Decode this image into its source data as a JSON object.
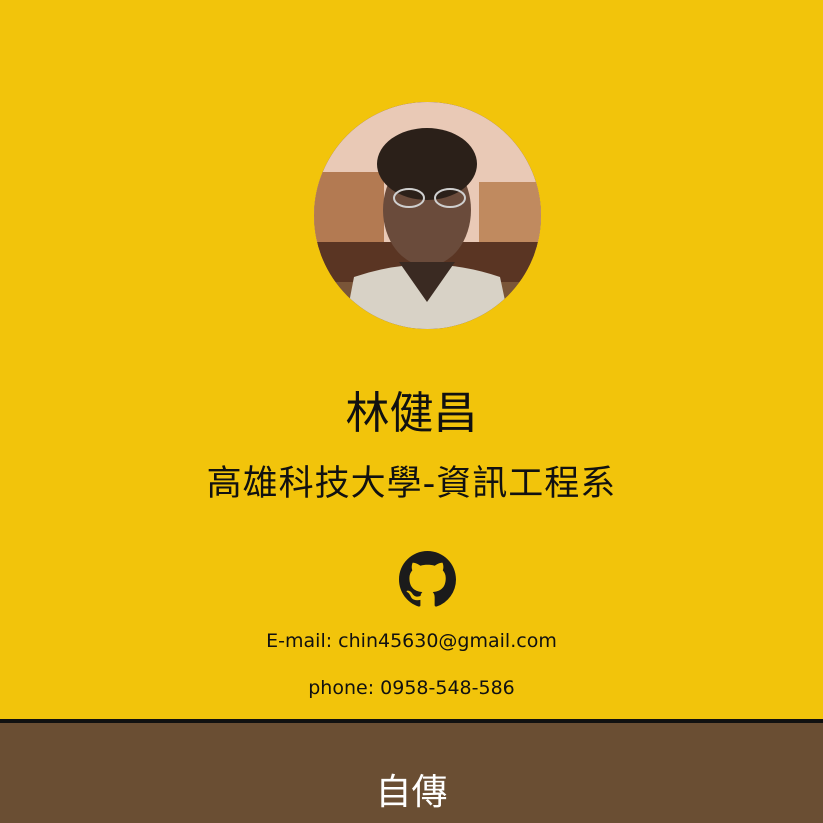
{
  "profile": {
    "name": "林健昌",
    "school": "高雄科技大學-資訊工程系",
    "email_text": "E-mail: chin45630@gmail.com",
    "phone_text": "phone: 0958-548-586"
  },
  "social": {
    "github_icon": "github-icon"
  },
  "sections": {
    "bio_title": "自傳"
  },
  "colors": {
    "hero_background": "#f2c40b",
    "bio_background": "#6a4e33",
    "divider": "#111111"
  }
}
